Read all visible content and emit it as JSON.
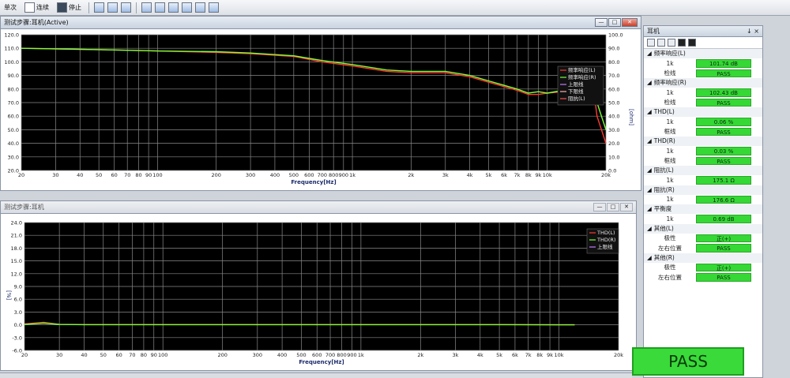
{
  "toolbar": {
    "items": [
      "单次",
      "连续",
      "停止"
    ]
  },
  "panel1": {
    "title": "测试步骤:耳机(Active)",
    "xlabel": "Frequency[Hz]",
    "y_right_label": "[ohm]",
    "legend": [
      "频率响应(L)",
      "频率响应(R)",
      "上限线",
      "下限线",
      "阻抗(L)"
    ]
  },
  "panel2": {
    "title": "测试步骤:耳机",
    "xlabel": "Frequency[Hz]",
    "ylabel": "[%]",
    "legend": [
      "THD(L)",
      "THD(R)",
      "上限线"
    ]
  },
  "side": {
    "title": "耳机",
    "pin": "↓ ×",
    "groups": [
      {
        "name": "频率响应(L)",
        "rows": [
          {
            "label": "1k",
            "value": "101.74 dB"
          },
          {
            "label": "检线",
            "value": "PASS"
          }
        ]
      },
      {
        "name": "频率响应(R)",
        "rows": [
          {
            "label": "1k",
            "value": "102.43 dB"
          },
          {
            "label": "检线",
            "value": "PASS"
          }
        ]
      },
      {
        "name": "THD(L)",
        "rows": [
          {
            "label": "1k",
            "value": "0.06 %"
          },
          {
            "label": "框线",
            "value": "PASS"
          }
        ]
      },
      {
        "name": "THD(R)",
        "rows": [
          {
            "label": "1k",
            "value": "0.03 %"
          },
          {
            "label": "框线",
            "value": "PASS"
          }
        ]
      },
      {
        "name": "阻抗(L)",
        "rows": [
          {
            "label": "1k",
            "value": "175.1 Ω"
          }
        ]
      },
      {
        "name": "阻抗(R)",
        "rows": [
          {
            "label": "1k",
            "value": "176.6 Ω"
          }
        ]
      },
      {
        "name": "平衡度",
        "rows": [
          {
            "label": "1k",
            "value": "0.69 dB"
          }
        ]
      },
      {
        "name": "其他(L)",
        "rows": [
          {
            "label": "极性",
            "value": "正(+)"
          },
          {
            "label": "左右位置",
            "value": "PASS"
          }
        ]
      },
      {
        "name": "其他(R)",
        "rows": [
          {
            "label": "极性",
            "value": "正(+)"
          },
          {
            "label": "左右位置",
            "value": "PASS"
          }
        ]
      }
    ]
  },
  "result": "PASS",
  "colors": {
    "fr_l": "#ff3b2f",
    "fr_r": "#7cff3a",
    "upper": "#c07bff",
    "lower": "#ffb0b0",
    "imp": "#ff5050",
    "thd_l": "#ff3b2f",
    "thd_r": "#7cff3a"
  },
  "chart_data": [
    {
      "type": "line",
      "title": "",
      "xlabel": "Frequency[Hz]",
      "ylabel": "",
      "x_scale": "log",
      "xlim": [
        20,
        20000
      ],
      "ylim": [
        20,
        120
      ],
      "y_ticks": [
        20,
        30,
        40,
        50,
        60,
        70,
        80,
        90,
        100,
        110,
        120
      ],
      "y2_ticks": [
        0,
        10,
        20,
        30,
        40,
        50,
        60,
        70,
        80,
        90,
        100
      ],
      "x_tick_labels": [
        "20",
        "30",
        "40",
        "50",
        "60",
        "70",
        "80",
        "90",
        "100",
        "200",
        "300",
        "400",
        "500",
        "600",
        "700",
        "800",
        "900",
        "1k",
        "2k",
        "3k",
        "4k",
        "5k",
        "6k",
        "7k",
        "8k",
        "9k",
        "10k",
        "20k"
      ],
      "x_tick_values": [
        20,
        30,
        40,
        50,
        60,
        70,
        80,
        90,
        100,
        200,
        300,
        400,
        500,
        600,
        700,
        800,
        900,
        1000,
        2000,
        3000,
        4000,
        5000,
        6000,
        7000,
        8000,
        9000,
        10000,
        20000
      ],
      "series": [
        {
          "name": "频率响应(L)",
          "x": [
            20,
            50,
            100,
            200,
            300,
            500,
            700,
            1000,
            1500,
            2000,
            3000,
            4000,
            5000,
            7000,
            8000,
            9000,
            10000,
            12000,
            14000,
            16000,
            17000,
            18000,
            20000
          ],
          "y": [
            110,
            109,
            108,
            107,
            106,
            104,
            100,
            97,
            93,
            92,
            92,
            89,
            85,
            79,
            76,
            76,
            77,
            78,
            80,
            84,
            88,
            60,
            40
          ]
        },
        {
          "name": "频率响应(R)",
          "x": [
            20,
            50,
            100,
            200,
            300,
            500,
            700,
            1000,
            1500,
            2000,
            3000,
            4000,
            5000,
            7000,
            8000,
            9000,
            10000,
            12000,
            14000,
            16000,
            17000,
            18000,
            20000
          ],
          "y": [
            110,
            109,
            108,
            107.5,
            106.5,
            104.5,
            101,
            98,
            94,
            93,
            93,
            90,
            86,
            80,
            77,
            78,
            77,
            79,
            80,
            83,
            86,
            70,
            50
          ]
        },
        {
          "name": "上限线",
          "x": [],
          "y": []
        },
        {
          "name": "下限线",
          "x": [],
          "y": []
        },
        {
          "name": "阻抗(L)",
          "x": [],
          "y": []
        }
      ],
      "grid": true,
      "legend": "top-right"
    },
    {
      "type": "line",
      "title": "",
      "xlabel": "Frequency[Hz]",
      "ylabel": "[%]",
      "x_scale": "log",
      "xlim": [
        20,
        20000
      ],
      "ylim": [
        -6,
        24
      ],
      "y_ticks": [
        -6,
        -3,
        0,
        3,
        6,
        9,
        12,
        15,
        18,
        21,
        24
      ],
      "x_tick_labels": [
        "20",
        "30",
        "40",
        "50",
        "60",
        "70",
        "80",
        "90",
        "100",
        "200",
        "300",
        "400",
        "500",
        "600",
        "700",
        "800",
        "900",
        "1k",
        "2k",
        "3k",
        "4k",
        "5k",
        "6k",
        "7k",
        "8k",
        "9k",
        "10k",
        "20k"
      ],
      "x_tick_values": [
        20,
        30,
        40,
        50,
        60,
        70,
        80,
        90,
        100,
        200,
        300,
        400,
        500,
        600,
        700,
        800,
        900,
        1000,
        2000,
        3000,
        4000,
        5000,
        6000,
        7000,
        8000,
        9000,
        10000,
        20000
      ],
      "series": [
        {
          "name": "THD(L)",
          "x": [
            20,
            25,
            30,
            40,
            100,
            1000,
            5000,
            10000,
            12000
          ],
          "y": [
            0.2,
            0.6,
            0.1,
            0.05,
            0.05,
            0.06,
            0.05,
            0.0,
            0.0
          ]
        },
        {
          "name": "THD(R)",
          "x": [
            20,
            25,
            30,
            40,
            100,
            1000,
            5000,
            10000,
            12000
          ],
          "y": [
            0.1,
            0.4,
            0.1,
            0.03,
            0.03,
            0.03,
            0.03,
            0.0,
            0.0
          ]
        },
        {
          "name": "上限线",
          "x": [],
          "y": []
        }
      ],
      "grid": true,
      "legend": "top-right"
    }
  ]
}
